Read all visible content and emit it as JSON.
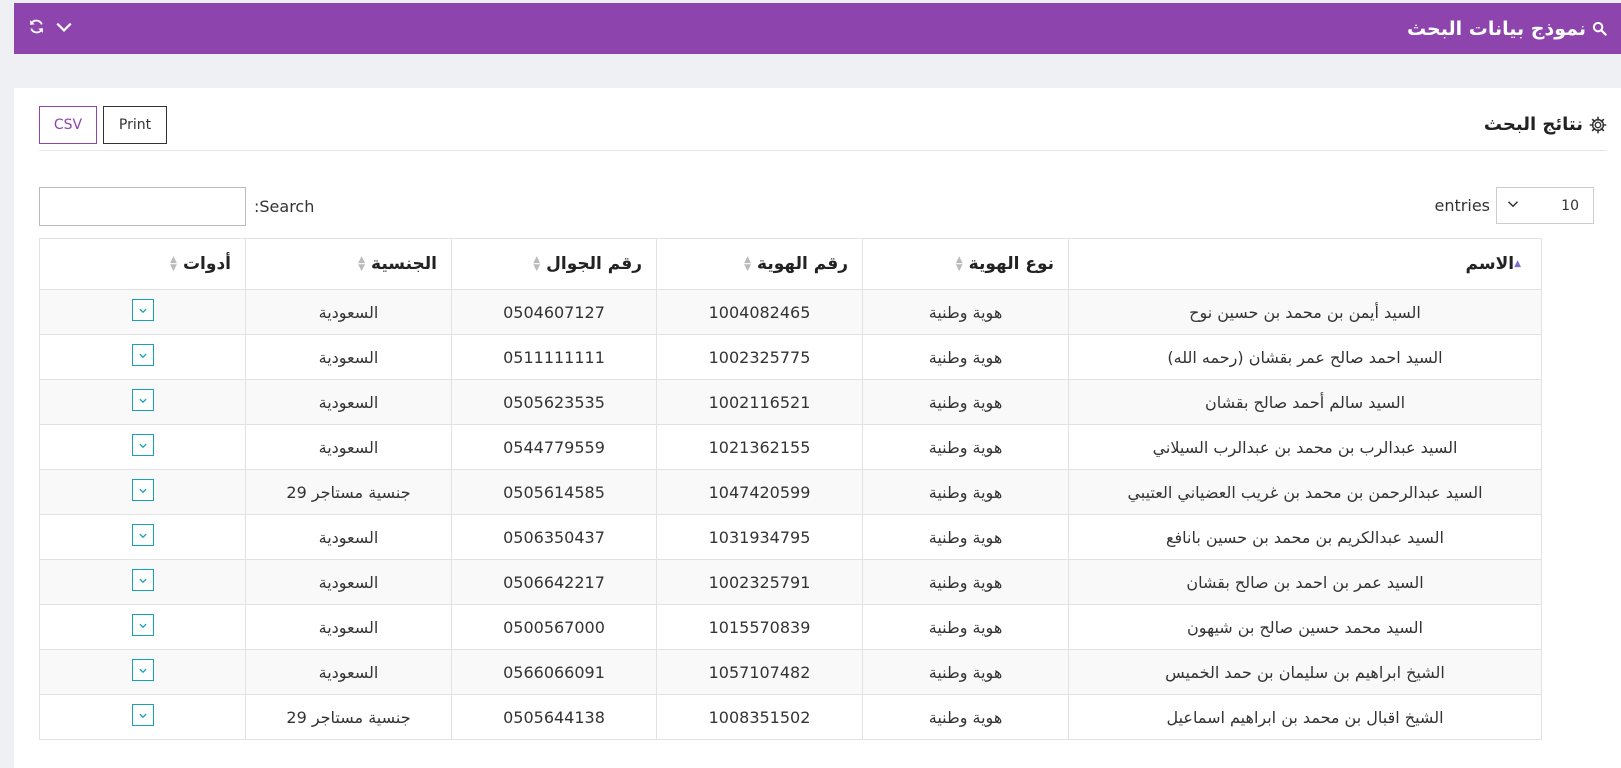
{
  "header": {
    "title": "نموذج بيانات البحث"
  },
  "results": {
    "title": "نتائج البحث",
    "csv_label": "CSV",
    "print_label": "Print"
  },
  "length": {
    "value": "10",
    "label": "entries"
  },
  "search": {
    "label": "Search:",
    "value": ""
  },
  "columns": [
    "الاسم",
    "نوع الهوية",
    "رقم الهوية",
    "رقم الجوال",
    "الجنسية",
    "أدوات"
  ],
  "rows": [
    [
      "السيد أيمن بن محمد بن حسين نوح",
      "هوية وطنية",
      "1004082465",
      "0504607127",
      "السعودية"
    ],
    [
      "السيد احمد صالح عمر بقشان (رحمه الله)",
      "هوية وطنية",
      "1002325775",
      "0511111111",
      "السعودية"
    ],
    [
      "السيد سالم أحمد صالح بقشان",
      "هوية وطنية",
      "1002116521",
      "0505623535",
      "السعودية"
    ],
    [
      "السيد عبدالرب بن محمد بن عبدالرب السيلاني",
      "هوية وطنية",
      "1021362155",
      "0544779559",
      "السعودية"
    ],
    [
      "السيد عبدالرحمن بن محمد بن غريب العضياني العتيبي",
      "هوية وطنية",
      "1047420599",
      "0505614585",
      "جنسية مستاجر 29"
    ],
    [
      "السيد عبدالكريم بن محمد بن حسين بانافع",
      "هوية وطنية",
      "1031934795",
      "0506350437",
      "السعودية"
    ],
    [
      "السيد عمر بن احمد بن صالح بقشان",
      "هوية وطنية",
      "1002325791",
      "0506642217",
      "السعودية"
    ],
    [
      "السيد محمد حسين صالح بن شيهون",
      "هوية وطنية",
      "1015570839",
      "0500567000",
      "السعودية"
    ],
    [
      "الشيخ ابراهيم بن سليمان بن حمد الخميس",
      "هوية وطنية",
      "1057107482",
      "0566066091",
      "السعودية"
    ],
    [
      "الشيخ اقبال بن محمد بن ابراهيم اسماعيل",
      "هوية وطنية",
      "1008351502",
      "0505644138",
      "جنسية مستاجر 29"
    ]
  ],
  "colors": {
    "accent": "#8e44ad",
    "tool_border": "#17a2b8"
  }
}
